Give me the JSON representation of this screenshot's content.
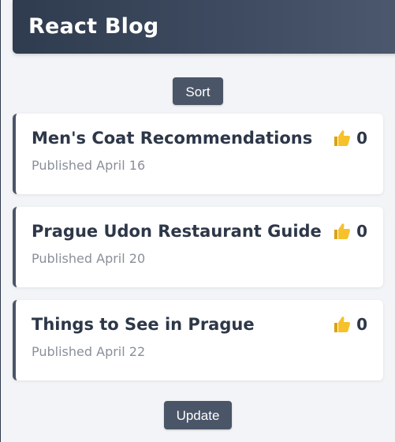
{
  "header": {
    "title": "React Blog"
  },
  "controls": {
    "sort_label": "Sort",
    "update_label": "Update"
  },
  "posts": [
    {
      "title": "Men's Coat Recommendations",
      "date": "Published April 16",
      "likes": "0",
      "like_icon": "thumbs-up-icon"
    },
    {
      "title": "Prague Udon Restaurant Guide",
      "date": "Published April 20",
      "likes": "0",
      "like_icon": "thumbs-up-icon"
    },
    {
      "title": "Things to See in Prague",
      "date": "Published April 22",
      "likes": "0",
      "like_icon": "thumbs-up-icon"
    }
  ],
  "colors": {
    "header_bg": "#2f3b4e",
    "button_bg": "#4a5568",
    "title_text": "#2d3748",
    "date_text": "#8a8f99",
    "thumb": "#f6c12b"
  }
}
